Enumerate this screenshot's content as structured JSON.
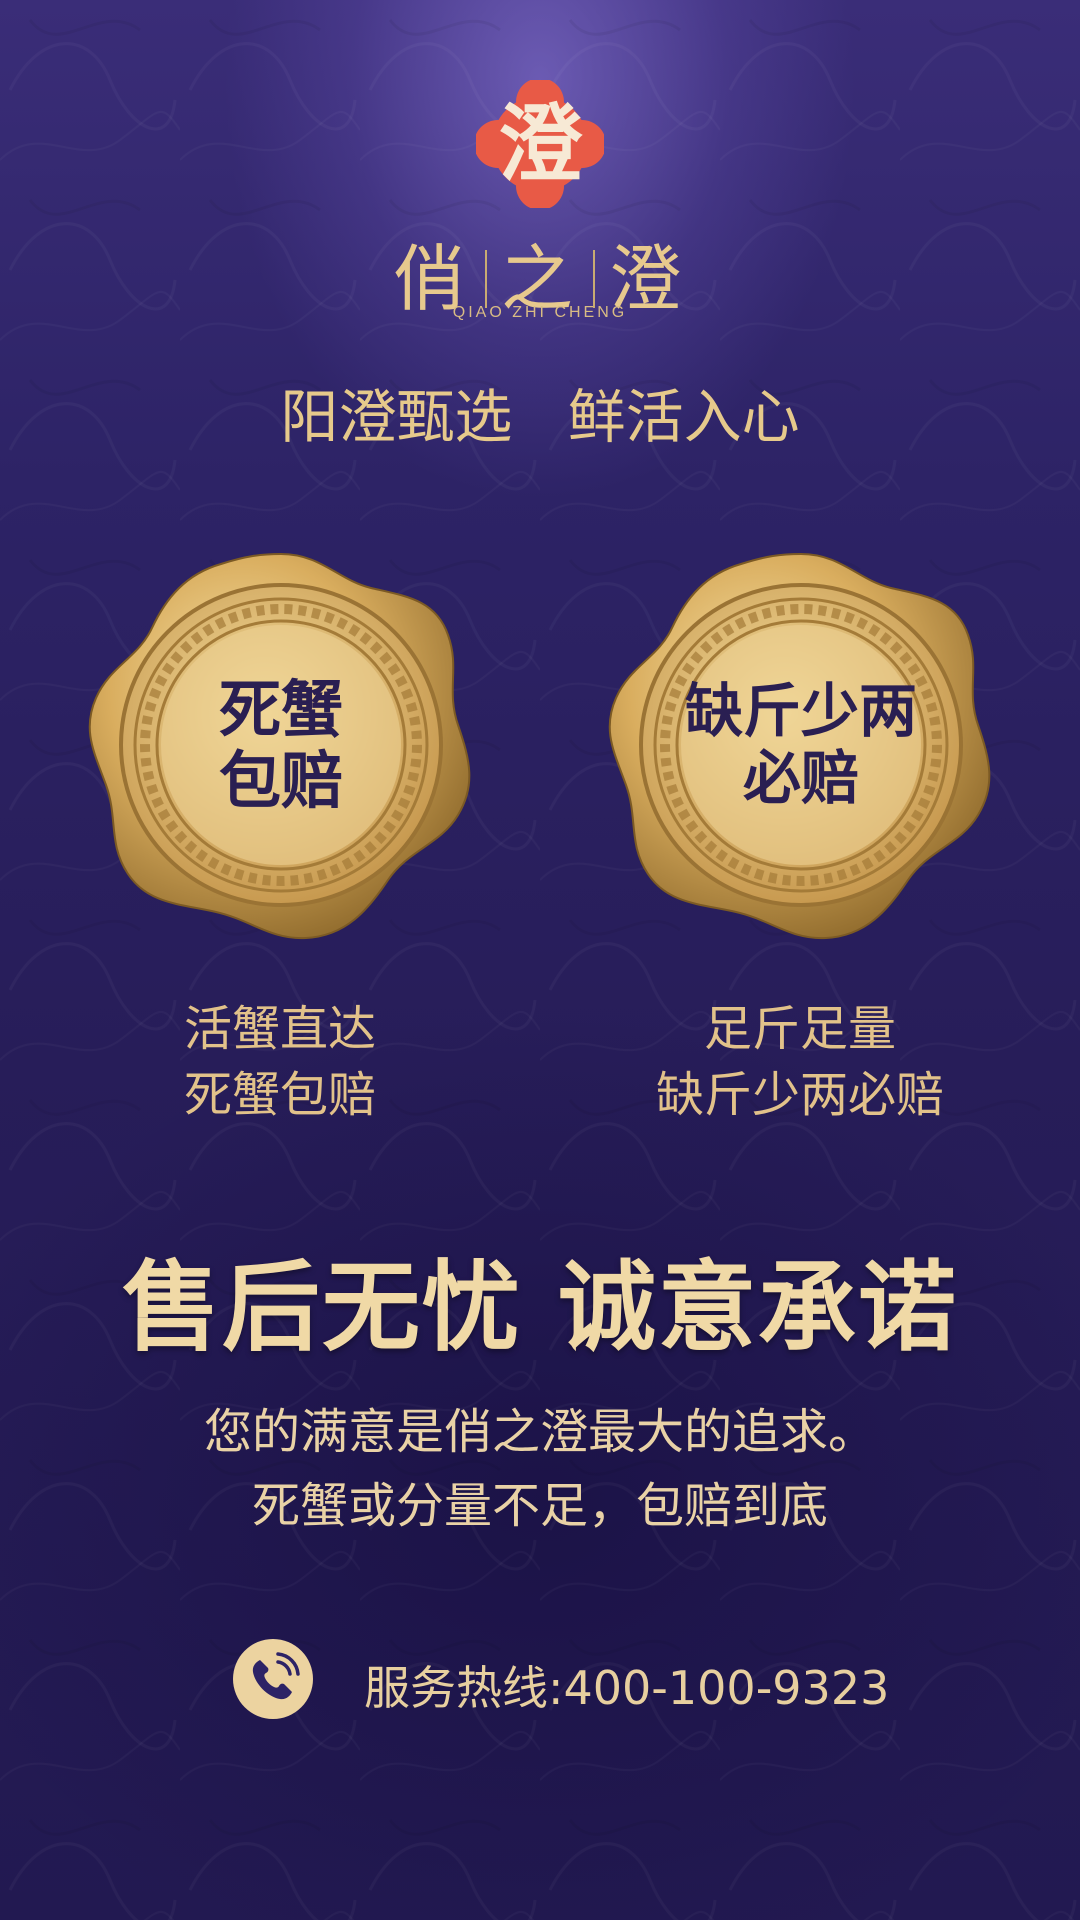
{
  "brand": {
    "seal_char": "澄",
    "name_parts": [
      "俏",
      "之",
      "澄"
    ],
    "subtitle": "QIAO ZHI CHENG",
    "seal_color": "#e85a46"
  },
  "tagline": "阳澄甄选   鲜活入心",
  "seals": [
    {
      "line1": "死蟹",
      "line2": "包赔"
    },
    {
      "line1": "缺斤少两",
      "line2": "必赔"
    }
  ],
  "features": [
    {
      "line1": "活蟹直达",
      "line2": "死蟹包赔"
    },
    {
      "line1": "足斤足量",
      "line2": "缺斤少两必赔"
    }
  ],
  "headline": "售后无忧 诚意承诺",
  "body": {
    "line1": "您的满意是俏之澄最大的追求。",
    "line2": "死蟹或分量不足，包赔到底"
  },
  "hotline": {
    "text": "服务热线:400-100-9323",
    "icon": "phone-icon"
  },
  "colors": {
    "background": "#2d2366",
    "gold": "#e6c98b",
    "seal_text": "#2a1f52"
  }
}
